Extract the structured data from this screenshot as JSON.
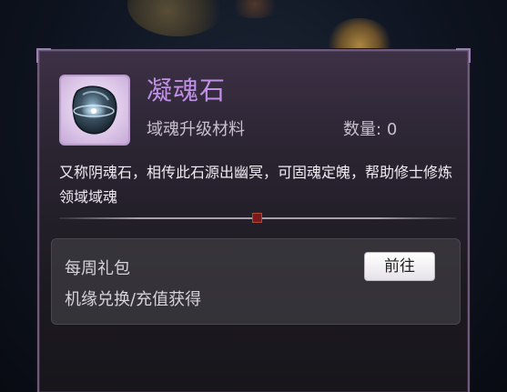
{
  "item": {
    "name": "凝魂石",
    "type": "域魂升级材料",
    "quantity_label": "数量",
    "quantity_sep": ":",
    "quantity_value": "0",
    "icon": "soul-stone-icon",
    "description": "又称阴魂石，相传此石源出幽冥，可固魂定魄，帮助修士修炼领域域魂"
  },
  "source": {
    "title": "每周礼包",
    "description": "机缘兑换/充值获得",
    "goto_label": "前往"
  },
  "colors": {
    "item_name": "#c08fe6",
    "panel_border": "#6e5a7d",
    "icon_background": "#e6d3f0"
  }
}
